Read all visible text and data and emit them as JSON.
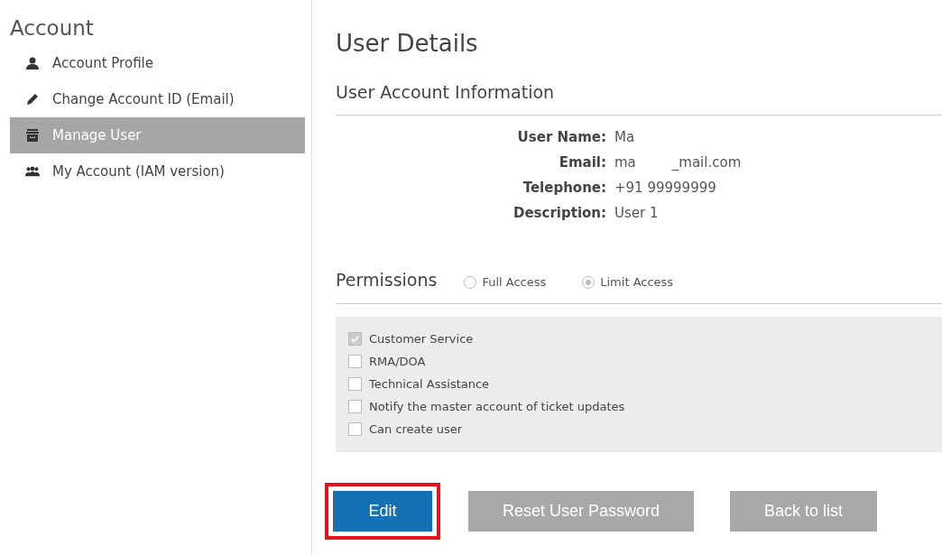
{
  "sidebar": {
    "title": "Account",
    "items": [
      {
        "label": "Account Profile",
        "kind": "profile",
        "selected": false
      },
      {
        "label": "Change Account ID (Email)",
        "kind": "edit",
        "selected": false
      },
      {
        "label": "Manage User",
        "kind": "manage",
        "selected": true
      },
      {
        "label": "My Account (IAM version)",
        "kind": "team",
        "selected": false
      }
    ]
  },
  "page_title": "User Details",
  "section_title": "User Account Information",
  "details": [
    {
      "label": "User Name:",
      "value_parts": [
        "Ma"
      ]
    },
    {
      "label": "Email:",
      "value_parts": [
        "ma",
        "_mail.com"
      ]
    },
    {
      "label": "Telephone:",
      "value_parts": [
        "+91 99999999"
      ]
    },
    {
      "label": "Description:",
      "value_parts": [
        "User 1"
      ]
    }
  ],
  "permissions": {
    "title": "Permissions",
    "options": [
      {
        "label": "Full Access",
        "selected": false
      },
      {
        "label": "Limit Access",
        "selected": true
      }
    ],
    "items": [
      {
        "label": "Customer Service",
        "checked": true
      },
      {
        "label": "RMA/DOA",
        "checked": false
      },
      {
        "label": "Technical Assistance",
        "checked": false
      },
      {
        "label": "Notify the master account of ticket updates",
        "checked": false
      },
      {
        "label": "Can create user",
        "checked": false
      }
    ]
  },
  "buttons": [
    {
      "label": "Edit",
      "kind": "primary",
      "highlighted": true
    },
    {
      "label": "Reset User Password",
      "kind": "secondary",
      "highlighted": false
    },
    {
      "label": "Back to list",
      "kind": "secondary",
      "highlighted": false
    }
  ]
}
